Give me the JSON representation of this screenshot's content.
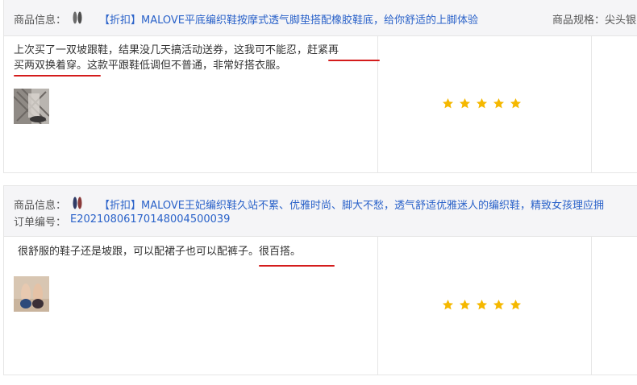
{
  "reviews": [
    {
      "product_info_label": "商品信息：",
      "product_name": "【折扣】MALOVE平底编织鞋按摩式透气脚垫搭配橡胶鞋底，给你舒适的上脚体验",
      "spec_label": "商品规格：",
      "spec_value": "尖头银",
      "review_line1": "上次买了一双坡跟鞋，结果没几天搞活动送券，这我可不能忍，赶紧再",
      "review_line2": "买两双换着穿。这款平跟鞋低调但不普通，非常好搭衣服。",
      "rating": 5
    },
    {
      "product_info_label": "商品信息：",
      "product_name": "【折扣】MALOVE王妃编织鞋久站不累、优雅时尚、脚大不愁，透气舒适优雅迷人的编织鞋，精致女孩理应拥",
      "order_label": "订单编号：",
      "order_number": "E20210806170148004500039",
      "review_line1": "很舒服的鞋子还是坡跟，可以配裙子也可以配裤子。很百搭。",
      "rating": 5
    }
  ],
  "colors": {
    "link": "#2a62c9",
    "star": "#f5b800",
    "underline": "#d41c1c",
    "header_bg": "#f5f5f7"
  }
}
